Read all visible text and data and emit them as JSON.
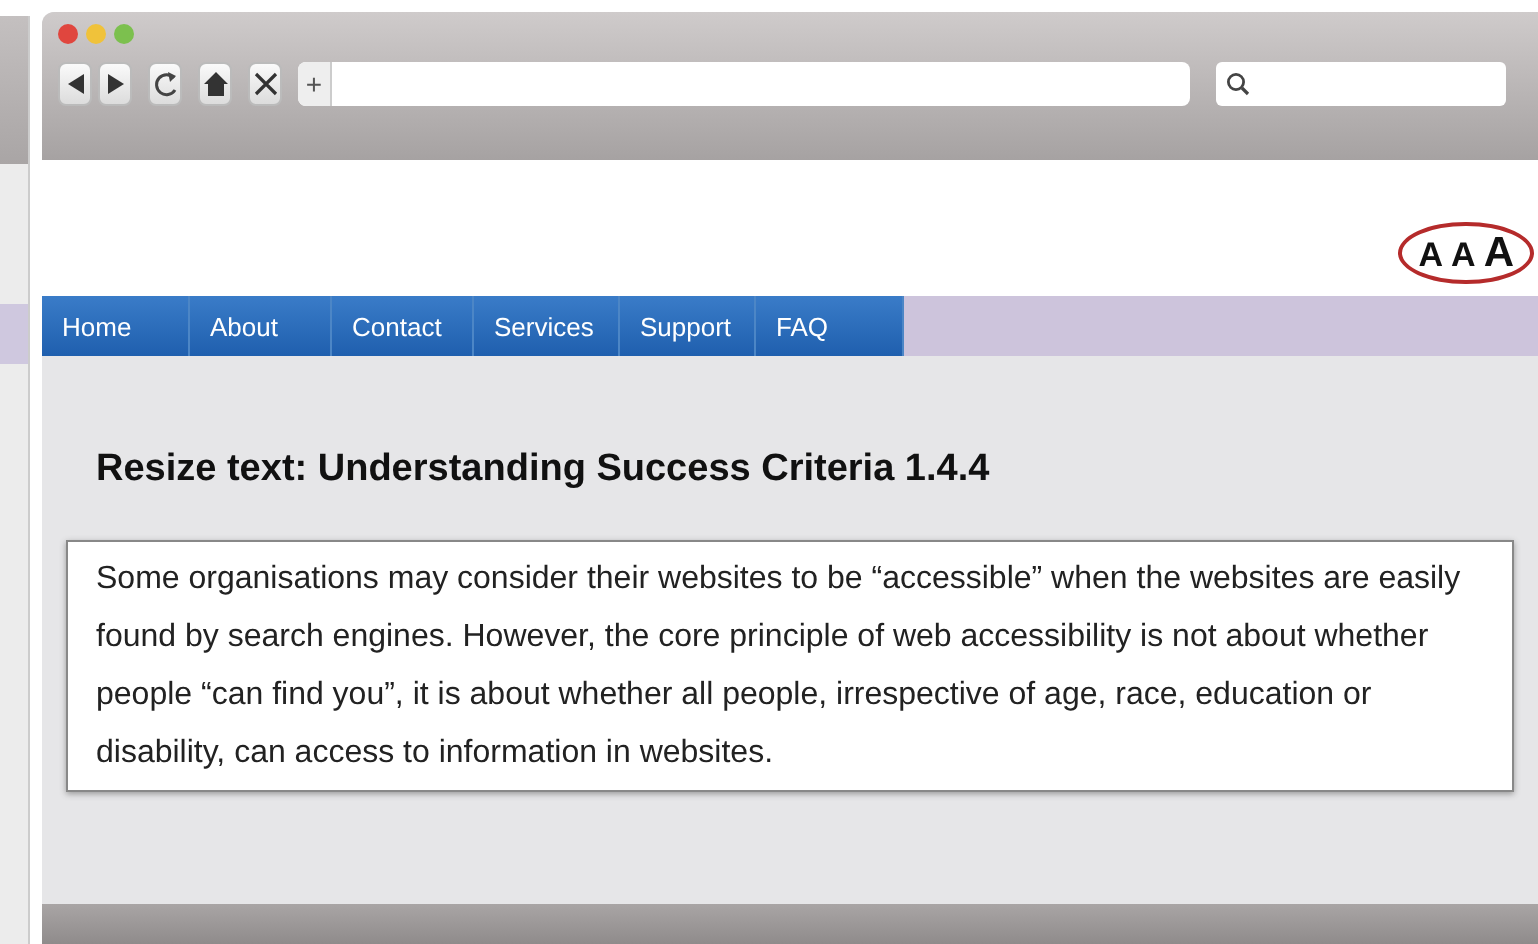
{
  "browser": {
    "new_tab": "+"
  },
  "font_sizes": [
    "A",
    "A",
    "A"
  ],
  "nav": [
    {
      "label": "Home",
      "selected": false
    },
    {
      "label": "About",
      "selected": false
    },
    {
      "label": "Contact",
      "selected": false
    },
    {
      "label": "Services",
      "selected": false
    },
    {
      "label": "Support",
      "selected": false
    },
    {
      "label": "FAQ",
      "selected": false
    }
  ],
  "heading": "Resize text: Understanding Success Criteria 1.4.4",
  "paragraph": "Some organisations may consider their websites to be “accessible” when the websites are easily found by search engines. However, the core principle of web accessibility is not about whether people “can find you”, it is about whether all people, irrespective of age, race, education or disability, can access to information in websites."
}
